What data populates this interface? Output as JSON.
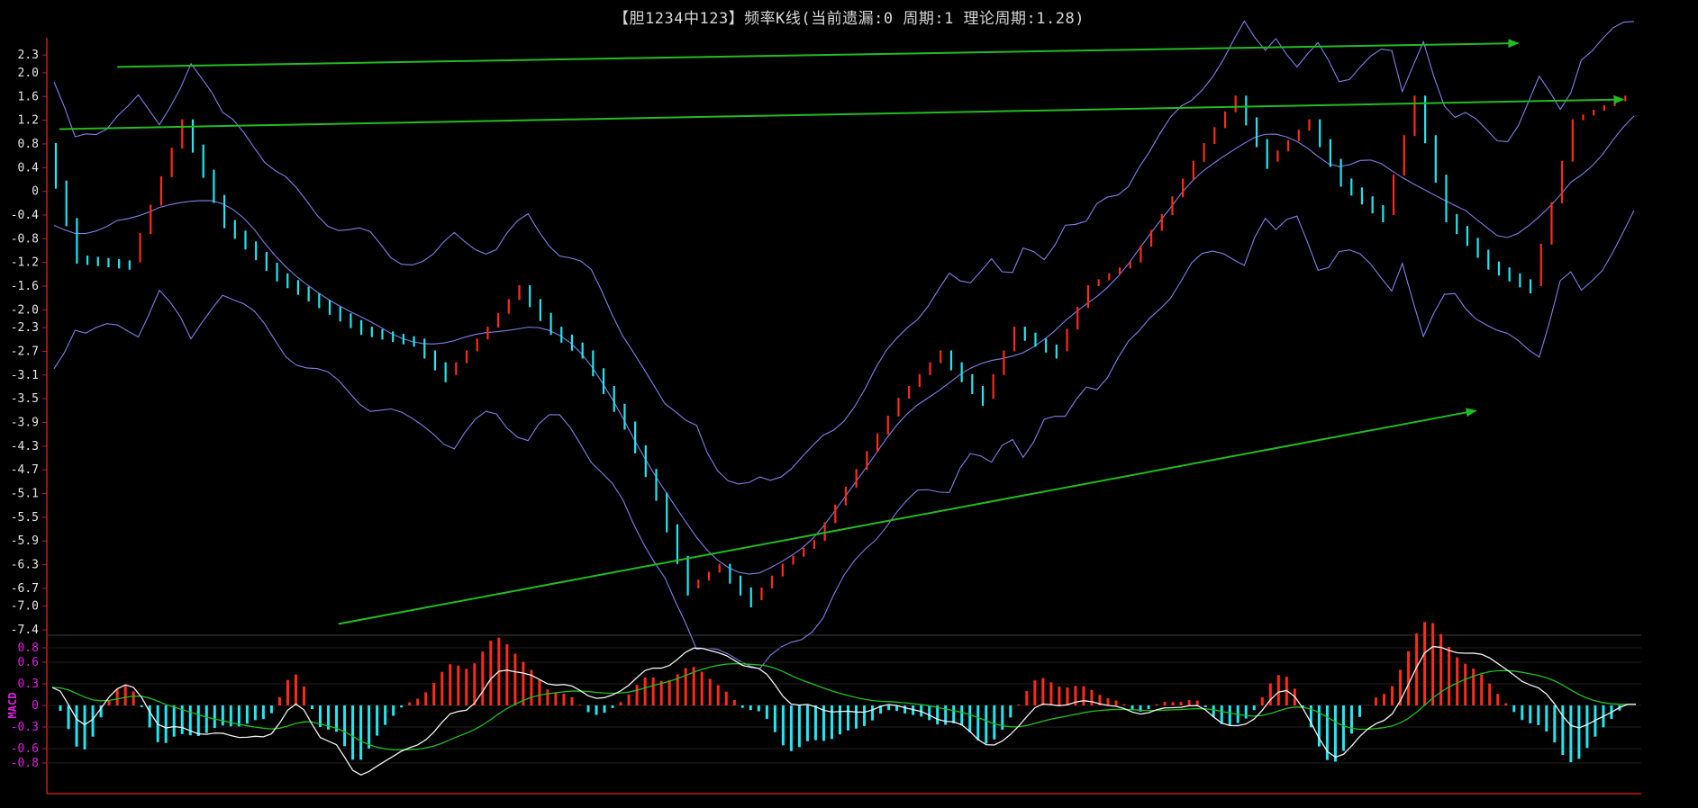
{
  "title": "【胆1234中123】频率K线(当前遗漏:0 周期:1 理论周期:1.28)",
  "colors": {
    "background": "#000000",
    "axis": "#c81e1e",
    "up_candle": "#ff2a1a",
    "down_candle": "#22e6f0",
    "band": "#7f7fe8",
    "trend_arrow": "#22bb22",
    "macd_fast": "#f2f2f2",
    "macd_slow": "#20c020",
    "macd_label": "#e01ee0",
    "tick_main": "#e6e6e6",
    "tick_macd": "#e01ee0"
  },
  "chart_data": [
    {
      "type": "candlestick",
      "panel": "main",
      "y_ticks": [
        "2.3",
        "2.0",
        "1.6",
        "1.2",
        "0.8",
        "0.4",
        "0",
        "-0.4",
        "-0.8",
        "-1.2",
        "-1.6",
        "-2.0",
        "-2.3",
        "-2.7",
        "-3.1",
        "-3.5",
        "-3.9",
        "-4.3",
        "-4.7",
        "-5.1",
        "-5.5",
        "-5.9",
        "-6.3",
        "-6.7",
        "-7.0",
        "-7.4"
      ],
      "ylim": [
        -7.4,
        2.5
      ],
      "x_count": 150,
      "path_keypoints": [
        [
          0,
          0.8
        ],
        [
          3,
          -1.1
        ],
        [
          8,
          -1.2
        ],
        [
          13,
          1.2
        ],
        [
          17,
          -0.5
        ],
        [
          22,
          -1.4
        ],
        [
          30,
          -2.3
        ],
        [
          35,
          -2.5
        ],
        [
          38,
          -3.1
        ],
        [
          42,
          -2.3
        ],
        [
          45,
          -1.6
        ],
        [
          48,
          -2.3
        ],
        [
          51,
          -2.7
        ],
        [
          55,
          -3.9
        ],
        [
          58,
          -5.1
        ],
        [
          61,
          -6.7
        ],
        [
          64,
          -6.3
        ],
        [
          67,
          -6.9
        ],
        [
          70,
          -6.3
        ],
        [
          73,
          -5.9
        ],
        [
          77,
          -4.7
        ],
        [
          81,
          -3.5
        ],
        [
          85,
          -2.7
        ],
        [
          89,
          -3.5
        ],
        [
          92,
          -2.3
        ],
        [
          96,
          -2.7
        ],
        [
          99,
          -1.6
        ],
        [
          103,
          -1.2
        ],
        [
          106,
          -0.4
        ],
        [
          110,
          0.8
        ],
        [
          113,
          1.6
        ],
        [
          116,
          0.5
        ],
        [
          120,
          1.2
        ],
        [
          123,
          0.2
        ],
        [
          127,
          -0.4
        ],
        [
          130,
          1.6
        ],
        [
          133,
          -0.4
        ],
        [
          137,
          -1.2
        ],
        [
          141,
          -1.6
        ],
        [
          145,
          1.2
        ],
        [
          150,
          1.6
        ]
      ],
      "up_steps": [
        0.25,
        0.35,
        0.35,
        0.3
      ],
      "down_steps": [
        0.45,
        0.4,
        0.5,
        0.35
      ],
      "band_offset": 0.6
    },
    {
      "type": "macd",
      "panel": "sub",
      "label": "MACD",
      "y_ticks": [
        "0.8",
        "0.6",
        "0.3",
        "0",
        "-0.3",
        "-0.6",
        "-0.8"
      ],
      "ylim": [
        -0.95,
        0.9
      ],
      "dif_keypoints": [
        [
          0,
          0.25
        ],
        [
          4,
          -0.25
        ],
        [
          9,
          0.3
        ],
        [
          14,
          -0.3
        ],
        [
          20,
          -0.4
        ],
        [
          26,
          -0.45
        ],
        [
          30,
          0.0
        ],
        [
          34,
          -0.5
        ],
        [
          38,
          -0.95
        ],
        [
          44,
          -0.6
        ],
        [
          50,
          -0.1
        ],
        [
          56,
          0.5
        ],
        [
          62,
          0.3
        ],
        [
          68,
          0.1
        ],
        [
          74,
          0.5
        ],
        [
          80,
          0.8
        ],
        [
          86,
          0.55
        ],
        [
          92,
          0.0
        ],
        [
          98,
          -0.1
        ],
        [
          104,
          0.0
        ],
        [
          110,
          -0.2
        ],
        [
          116,
          -0.55
        ],
        [
          122,
          0.0
        ],
        [
          128,
          0.05
        ],
        [
          134,
          -0.1
        ],
        [
          140,
          0.0
        ],
        [
          146,
          -0.3
        ],
        [
          152,
          0.2
        ],
        [
          158,
          -0.7
        ],
        [
          164,
          -0.2
        ],
        [
          170,
          0.8
        ],
        [
          176,
          0.7
        ],
        [
          182,
          0.3
        ],
        [
          188,
          -0.3
        ],
        [
          194,
          0.0
        ]
      ],
      "dea_smoothing": 0.12,
      "hist_x_count": 195
    }
  ],
  "trend_arrows": [
    {
      "from": [
        6,
        2.1
      ],
      "to": [
        139,
        2.5
      ],
      "from_y_offset": 0.0
    },
    {
      "from": [
        0.5,
        1.05
      ],
      "to": [
        149,
        1.55
      ]
    },
    {
      "from": [
        27,
        -7.3
      ],
      "to": [
        135,
        -3.7
      ]
    }
  ]
}
